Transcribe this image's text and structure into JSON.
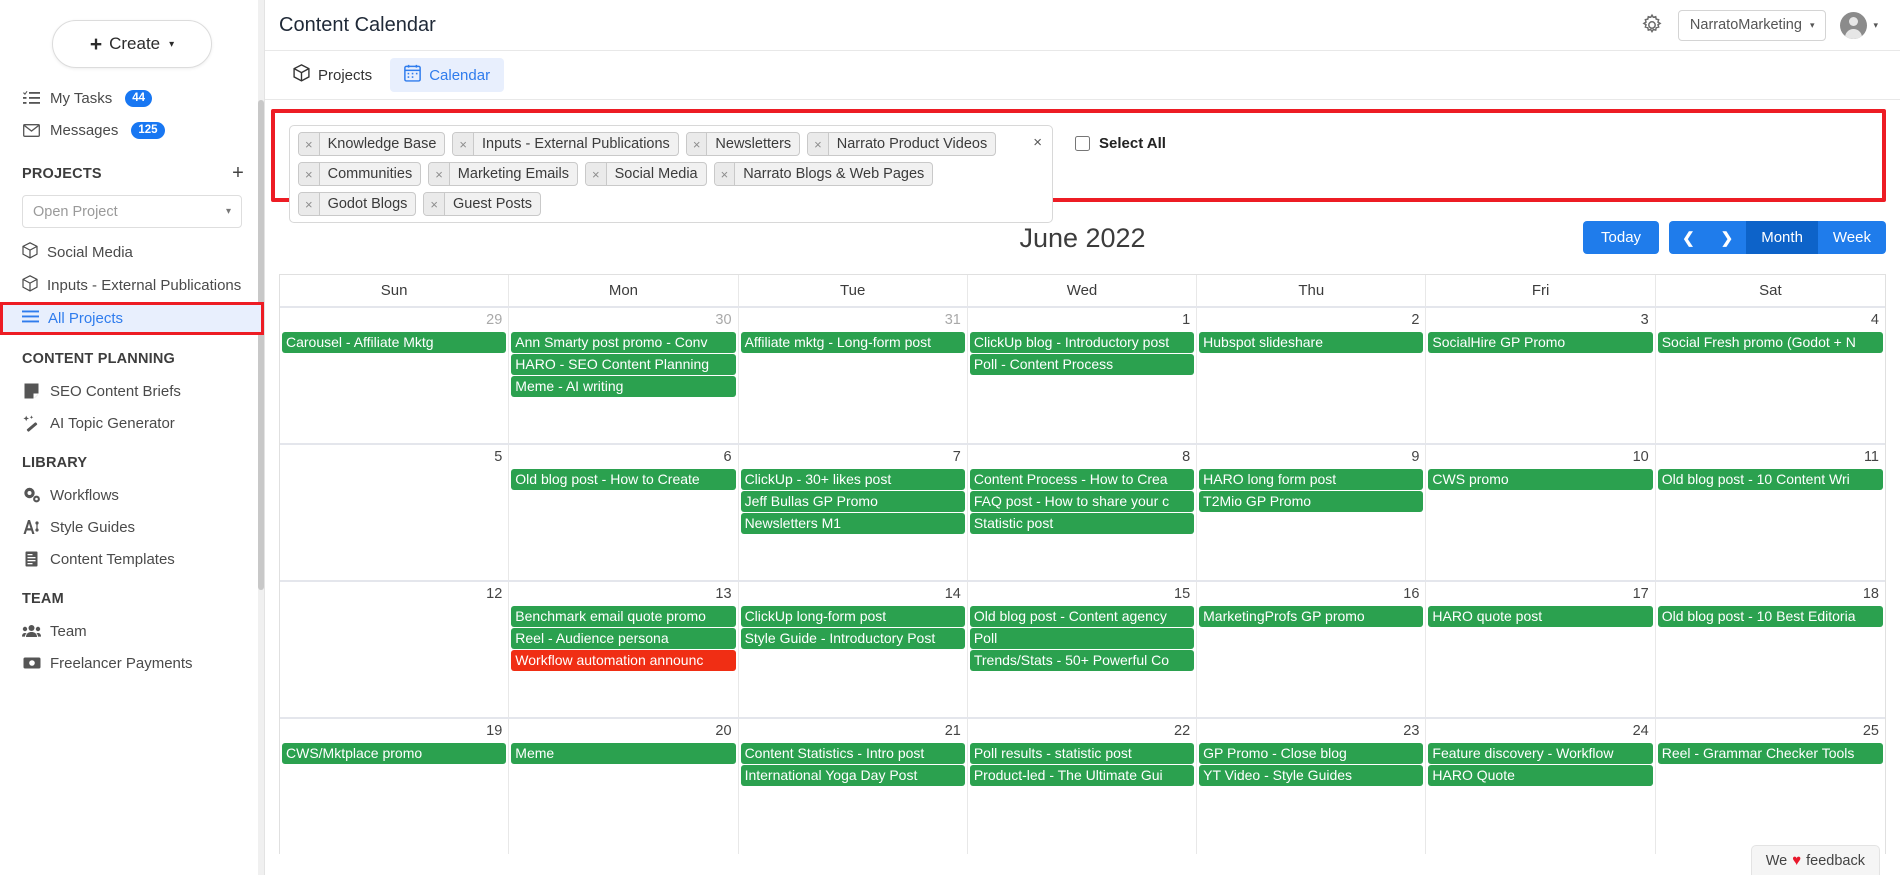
{
  "sidebar": {
    "create_button": {
      "label": "Create",
      "icon": "plus-icon",
      "caret": "▾"
    },
    "quick_links": [
      {
        "label": "My Tasks",
        "icon": "tasks-icon",
        "badge": "44"
      },
      {
        "label": "Messages",
        "icon": "envelope-icon",
        "badge": "125"
      }
    ],
    "projects_section": {
      "title": "PROJECTS",
      "add_icon": "plus-icon"
    },
    "project_select": {
      "placeholder": "Open Project",
      "caret": "▾"
    },
    "projects": [
      {
        "label": "Social Media",
        "icon": "cube-icon",
        "active": false
      },
      {
        "label": "Inputs - External Publications",
        "icon": "cube-icon",
        "active": false
      },
      {
        "label": "All Projects",
        "icon": "list-icon",
        "active": true
      }
    ],
    "content_planning_section": "CONTENT PLANNING",
    "content_planning": [
      {
        "label": "SEO Content Briefs",
        "icon": "document-icon"
      },
      {
        "label": "AI Topic Generator",
        "icon": "magic-wand-icon"
      }
    ],
    "library_section": "LIBRARY",
    "library": [
      {
        "label": "Workflows",
        "icon": "gears-icon"
      },
      {
        "label": "Style Guides",
        "icon": "style-icon"
      },
      {
        "label": "Content Templates",
        "icon": "template-icon"
      }
    ],
    "team_section": "TEAM",
    "team": [
      {
        "label": "Team",
        "icon": "users-icon"
      },
      {
        "label": "Freelancer Payments",
        "icon": "money-icon"
      }
    ]
  },
  "header": {
    "page_title": "Content Calendar",
    "gear_icon": "gear-icon",
    "org_name": "NarratoMarketing",
    "org_caret": "▾",
    "avatar_icon": "avatar-icon",
    "avatar_caret": "▾"
  },
  "tabs": [
    {
      "label": "Projects",
      "icon": "cube-icon",
      "active": false
    },
    {
      "label": "Calendar",
      "icon": "calendar-icon",
      "active": true
    }
  ],
  "filters": {
    "chips": [
      "Knowledge Base",
      "Inputs - External Publications",
      "Newsletters",
      "Narrato Product Videos",
      "Communities",
      "Marketing Emails",
      "Social Media",
      "Narrato Blogs & Web Pages",
      "Godot Blogs",
      "Guest Posts"
    ],
    "chip_remove_icon": "×",
    "clear_all_icon": "×",
    "select_all_label": "Select All",
    "select_all_checked": false,
    "annotation_color": "#ed1c24"
  },
  "calendar": {
    "month_title": "June 2022",
    "today_label": "Today",
    "prev_icon": "chevron-left-icon",
    "next_icon": "chevron-right-icon",
    "views": [
      {
        "label": "Month",
        "active": true
      },
      {
        "label": "Week",
        "active": false
      }
    ],
    "day_headers": [
      "Sun",
      "Mon",
      "Tue",
      "Wed",
      "Thu",
      "Fri",
      "Sat"
    ],
    "event_colors": {
      "default": "#2ba14f",
      "alert": "#f02e14"
    },
    "weeks": [
      [
        {
          "day": "29",
          "muted": true,
          "events": [
            {
              "text": "Carousel - Affiliate Mktg",
              "color": "default"
            }
          ]
        },
        {
          "day": "30",
          "muted": true,
          "events": [
            {
              "text": "Ann Smarty post promo - Conv",
              "color": "default"
            },
            {
              "text": "HARO - SEO Content Planning",
              "color": "default"
            },
            {
              "text": "Meme - AI writing",
              "color": "default"
            }
          ]
        },
        {
          "day": "31",
          "muted": true,
          "events": [
            {
              "text": "Affiliate mktg - Long-form post",
              "color": "default"
            }
          ]
        },
        {
          "day": "1",
          "muted": false,
          "events": [
            {
              "text": "ClickUp blog - Introductory post",
              "color": "default"
            },
            {
              "text": "Poll - Content Process",
              "color": "default"
            }
          ]
        },
        {
          "day": "2",
          "muted": false,
          "events": [
            {
              "text": "Hubspot slideshare",
              "color": "default"
            }
          ]
        },
        {
          "day": "3",
          "muted": false,
          "events": [
            {
              "text": "SocialHire GP Promo",
              "color": "default"
            }
          ]
        },
        {
          "day": "4",
          "muted": false,
          "events": [
            {
              "text": "Social Fresh promo (Godot + N",
              "color": "default"
            }
          ]
        }
      ],
      [
        {
          "day": "5",
          "muted": false,
          "events": []
        },
        {
          "day": "6",
          "muted": false,
          "events": [
            {
              "text": "Old blog post - How to Create",
              "color": "default"
            }
          ]
        },
        {
          "day": "7",
          "muted": false,
          "events": [
            {
              "text": "ClickUp - 30+ likes post",
              "color": "default"
            },
            {
              "text": "Jeff Bullas GP Promo",
              "color": "default"
            },
            {
              "text": "Newsletters M1",
              "color": "default"
            }
          ]
        },
        {
          "day": "8",
          "muted": false,
          "events": [
            {
              "text": "Content Process - How to Crea",
              "color": "default"
            },
            {
              "text": "FAQ post - How to share your c",
              "color": "default"
            },
            {
              "text": "Statistic post",
              "color": "default"
            }
          ]
        },
        {
          "day": "9",
          "muted": false,
          "events": [
            {
              "text": "HARO long form post",
              "color": "default"
            },
            {
              "text": "T2Mio GP Promo",
              "color": "default"
            }
          ]
        },
        {
          "day": "10",
          "muted": false,
          "events": [
            {
              "text": "CWS promo",
              "color": "default"
            }
          ]
        },
        {
          "day": "11",
          "muted": false,
          "events": [
            {
              "text": "Old blog post - 10 Content Wri",
              "color": "default"
            }
          ]
        }
      ],
      [
        {
          "day": "12",
          "muted": false,
          "events": []
        },
        {
          "day": "13",
          "muted": false,
          "events": [
            {
              "text": "Benchmark email quote promo",
              "color": "default"
            },
            {
              "text": "Reel - Audience persona",
              "color": "default"
            },
            {
              "text": "Workflow automation announc",
              "color": "alert"
            }
          ]
        },
        {
          "day": "14",
          "muted": false,
          "events": [
            {
              "text": "ClickUp long-form post",
              "color": "default"
            },
            {
              "text": "Style Guide - Introductory Post",
              "color": "default"
            }
          ]
        },
        {
          "day": "15",
          "muted": false,
          "events": [
            {
              "text": "Old blog post - Content agency",
              "color": "default"
            },
            {
              "text": "Poll",
              "color": "default"
            },
            {
              "text": "Trends/Stats - 50+ Powerful Co",
              "color": "default"
            }
          ]
        },
        {
          "day": "16",
          "muted": false,
          "events": [
            {
              "text": "MarketingProfs GP promo",
              "color": "default"
            }
          ]
        },
        {
          "day": "17",
          "muted": false,
          "events": [
            {
              "text": "HARO quote post",
              "color": "default"
            }
          ]
        },
        {
          "day": "18",
          "muted": false,
          "events": [
            {
              "text": "Old blog post - 10 Best Editoria",
              "color": "default"
            }
          ]
        }
      ],
      [
        {
          "day": "19",
          "muted": false,
          "events": [
            {
              "text": "CWS/Mktplace promo",
              "color": "default"
            }
          ]
        },
        {
          "day": "20",
          "muted": false,
          "events": [
            {
              "text": "Meme",
              "color": "default"
            }
          ]
        },
        {
          "day": "21",
          "muted": false,
          "events": [
            {
              "text": "Content Statistics - Intro post",
              "color": "default"
            },
            {
              "text": "International Yoga Day Post",
              "color": "default"
            }
          ]
        },
        {
          "day": "22",
          "muted": false,
          "events": [
            {
              "text": "Poll results - statistic post",
              "color": "default"
            },
            {
              "text": "Product-led - The Ultimate Gui",
              "color": "default"
            }
          ]
        },
        {
          "day": "23",
          "muted": false,
          "events": [
            {
              "text": "GP Promo - Close blog",
              "color": "default"
            },
            {
              "text": "YT Video - Style Guides",
              "color": "default"
            }
          ]
        },
        {
          "day": "24",
          "muted": false,
          "events": [
            {
              "text": "Feature discovery - Workflow",
              "color": "default"
            },
            {
              "text": "HARO Quote",
              "color": "default"
            }
          ]
        },
        {
          "day": "25",
          "muted": false,
          "events": [
            {
              "text": "Reel - Grammar Checker Tools",
              "color": "default"
            }
          ]
        }
      ]
    ]
  },
  "feedback": {
    "prefix": "We",
    "heart": "♥",
    "suffix": "feedback"
  }
}
